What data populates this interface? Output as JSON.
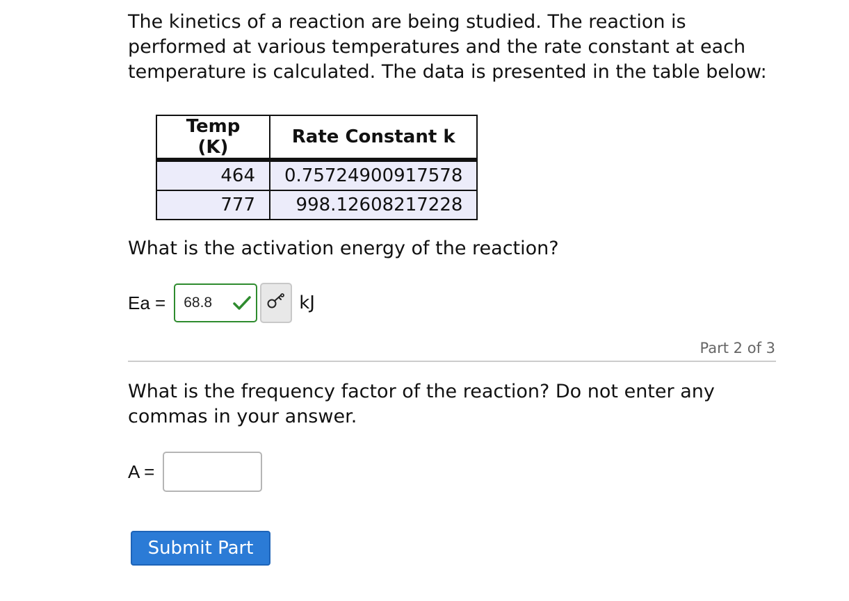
{
  "intro": {
    "text": "The kinetics of a reaction are being studied. The reaction is performed at various temperatures and the rate constant at each temperature is calculated. The data is presented in the table below:"
  },
  "table": {
    "headers": [
      "Temp (K)",
      "Rate Constant k"
    ],
    "rows": [
      [
        "464",
        "0.75724900917578"
      ],
      [
        "777",
        "998.12608217228"
      ]
    ]
  },
  "part1": {
    "question": "What is the activation energy of the reaction?",
    "variable": "Ea",
    "equals": "=",
    "answer": "68.8",
    "answer_status": "correct",
    "unit": "kJ",
    "icons": {
      "status": "check-icon",
      "button": "key-icon"
    },
    "colors": {
      "correct": "#2e8b2e"
    }
  },
  "part_indicator": "Part 2 of 3",
  "part2": {
    "question": "What is the frequency factor of the reaction? Do not enter any commas in your answer.",
    "variable": "A",
    "equals": "=",
    "value": ""
  },
  "submit": {
    "label": "Submit Part",
    "color": "#2b7bd6"
  }
}
